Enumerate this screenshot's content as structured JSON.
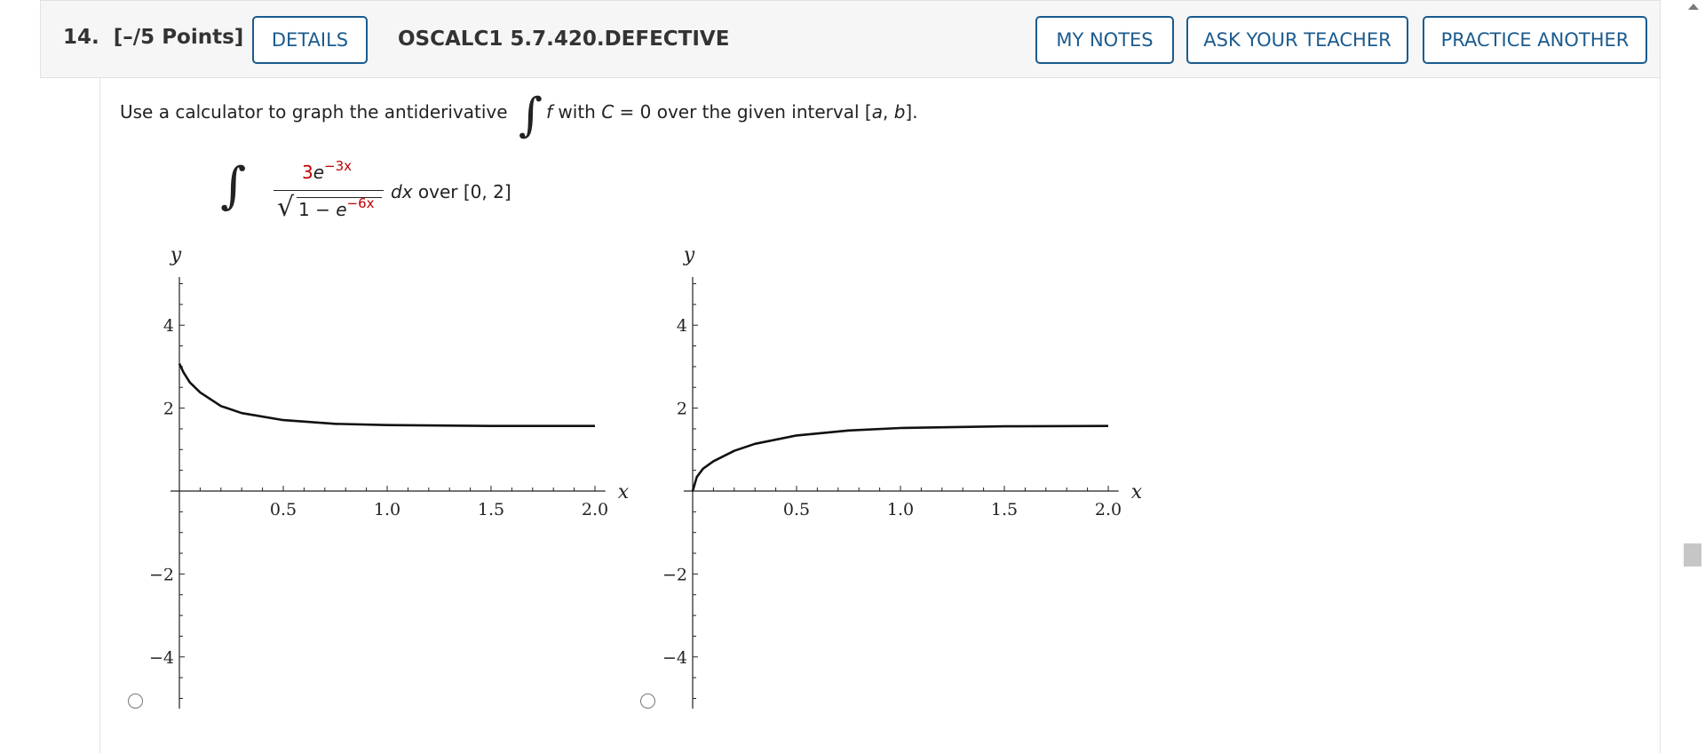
{
  "header": {
    "question_number": "14.",
    "points": "[–/5 Points]",
    "details_label": "DETAILS",
    "question_code": "OSCALC1 5.7.420.DEFECTIVE",
    "my_notes_label": "MY NOTES",
    "ask_teacher_label": "ASK YOUR TEACHER",
    "practice_another_label": "PRACTICE ANOTHER"
  },
  "question": {
    "instruction_pre": "Use a calculator to graph the antiderivative",
    "integral_symbol": "∫",
    "instruction_f": "f",
    "instruction_with": "with",
    "instruction_C": "C",
    "instruction_eq": "= 0 over the given interval [",
    "instruction_a": "a",
    "instruction_comma": ", ",
    "instruction_b": "b",
    "instruction_end": "].",
    "formula": {
      "numerator_coef": "3",
      "numerator_base": "e",
      "numerator_exp": "−3x",
      "denominator_prefix": "1 − ",
      "denominator_base": "e",
      "denominator_exp": "−6x",
      "dx": "dx",
      "over": "over [0, 2]"
    }
  },
  "chart_data": [
    {
      "type": "line",
      "xlabel": "x",
      "ylabel": "y",
      "xlim": [
        -0.05,
        2.05
      ],
      "ylim": [
        -5,
        5
      ],
      "x_ticks": [
        "0.5",
        "1.0",
        "1.5",
        "2.0"
      ],
      "y_ticks": [
        "4",
        "2",
        "−2",
        "−4"
      ],
      "series": [
        {
          "x": [
            0.0,
            0.02,
            0.05,
            0.1,
            0.2,
            0.3,
            0.5,
            0.75,
            1.0,
            1.5,
            2.0
          ],
          "y": [
            3.07,
            2.86,
            2.62,
            2.38,
            2.05,
            1.88,
            1.71,
            1.62,
            1.59,
            1.57,
            1.57
          ]
        }
      ],
      "selected": false
    },
    {
      "type": "line",
      "xlabel": "x",
      "ylabel": "y",
      "xlim": [
        -0.05,
        2.05
      ],
      "ylim": [
        -5,
        5
      ],
      "x_ticks": [
        "0.5",
        "1.0",
        "1.5",
        "2.0"
      ],
      "y_ticks": [
        "4",
        "2",
        "−2",
        "−4"
      ],
      "series": [
        {
          "x": [
            0.0,
            0.02,
            0.05,
            0.1,
            0.2,
            0.3,
            0.5,
            0.75,
            1.0,
            1.5,
            2.0
          ],
          "y": [
            0.0,
            0.34,
            0.54,
            0.72,
            0.97,
            1.14,
            1.34,
            1.46,
            1.52,
            1.56,
            1.57
          ]
        }
      ],
      "selected": false
    }
  ]
}
